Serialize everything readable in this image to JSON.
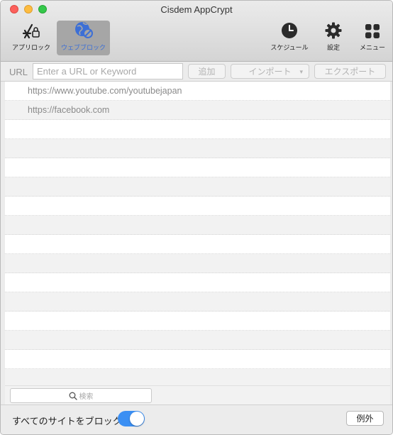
{
  "window": {
    "title": "Cisdem AppCrypt"
  },
  "toolbar": {
    "app_lock_label": "アプリロック",
    "web_block_label": "ウェブブロック",
    "schedule_label": "スケジュール",
    "settings_label": "設定",
    "menu_label": "メニュー",
    "selected": "web_block",
    "selected_color": "#3c6fd6"
  },
  "urlbar": {
    "label": "URL",
    "placeholder": "Enter a URL or Keyword",
    "value": "",
    "add_label": "追加",
    "import_label": "インポート",
    "export_label": "エクスポート"
  },
  "list": {
    "items": [
      "https://www.youtube.com/youtubejapan",
      "https://facebook.com",
      "",
      "",
      "",
      "",
      "",
      "",
      "",
      "",
      "",
      "",
      "",
      "",
      "",
      ""
    ]
  },
  "search": {
    "placeholder": "検索",
    "icon": "search-icon"
  },
  "bottom": {
    "block_all_label": "すべてのサイトをブロック",
    "block_all_enabled": true,
    "toggle_color": "#3b8ff3",
    "exceptions_label": "例外"
  }
}
